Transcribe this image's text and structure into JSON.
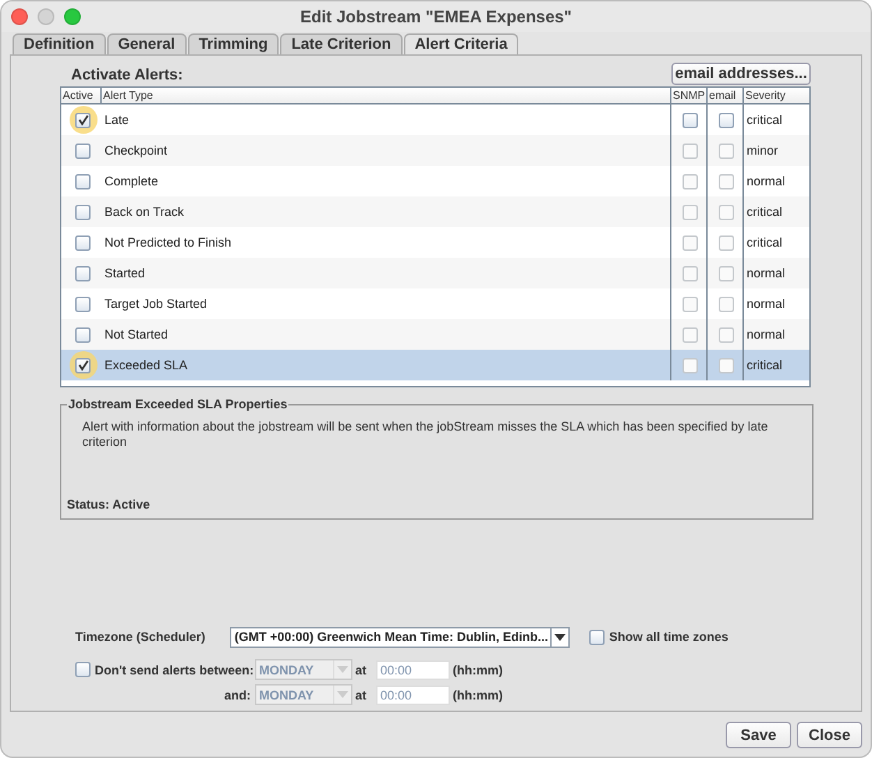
{
  "window": {
    "title": "Edit Jobstream \"EMEA Expenses\""
  },
  "tabs": [
    {
      "label": "Definition",
      "selected": false
    },
    {
      "label": "General",
      "selected": false
    },
    {
      "label": "Trimming",
      "selected": false
    },
    {
      "label": "Late Criterion",
      "selected": false
    },
    {
      "label": "Alert Criteria",
      "selected": true
    }
  ],
  "alerts_label": "Activate Alerts:",
  "email_button": "email addresses...",
  "table": {
    "columns": [
      "Active",
      "Alert Type",
      "SNMP",
      "email",
      "Severity"
    ],
    "rows": [
      {
        "active": true,
        "type": "Late",
        "snmp": false,
        "email": false,
        "severity": "critical",
        "selected": false
      },
      {
        "active": false,
        "type": "Checkpoint",
        "snmp": false,
        "email": false,
        "severity": "minor",
        "selected": false
      },
      {
        "active": false,
        "type": "Complete",
        "snmp": false,
        "email": false,
        "severity": "normal",
        "selected": false
      },
      {
        "active": false,
        "type": "Back on Track",
        "snmp": false,
        "email": false,
        "severity": "critical",
        "selected": false
      },
      {
        "active": false,
        "type": "Not Predicted to Finish",
        "snmp": false,
        "email": false,
        "severity": "critical",
        "selected": false
      },
      {
        "active": false,
        "type": "Started",
        "snmp": false,
        "email": false,
        "severity": "normal",
        "selected": false
      },
      {
        "active": false,
        "type": "Target Job Started",
        "snmp": false,
        "email": false,
        "severity": "normal",
        "selected": false
      },
      {
        "active": false,
        "type": "Not Started",
        "snmp": false,
        "email": false,
        "severity": "normal",
        "selected": false
      },
      {
        "active": true,
        "type": "Exceeded SLA",
        "snmp": false,
        "email": false,
        "severity": "critical",
        "selected": true
      }
    ]
  },
  "properties": {
    "title": "Jobstream Exceeded SLA Properties",
    "description": "Alert with information about the jobstream will be sent when the jobStream misses the SLA which has been specified by late criterion",
    "status": "Status: Active"
  },
  "timezone": {
    "label": "Timezone (Scheduler)",
    "value": "(GMT +00:00) Greenwich Mean Time: Dublin, Edinb...",
    "show_all": {
      "label": "Show all time zones",
      "checked": false
    }
  },
  "quiet_period": {
    "checked": false,
    "label": "Don't send alerts between:",
    "rows": [
      {
        "label": "",
        "day": "MONDAY",
        "at": "at",
        "time": "00:00",
        "unit": "(hh:mm)",
        "disabled": true
      },
      {
        "label": "and:",
        "day": "MONDAY",
        "at": "at",
        "time": "00:00",
        "unit": "(hh:mm)",
        "disabled": true
      }
    ]
  },
  "buttons": [
    "Save",
    "Close"
  ]
}
